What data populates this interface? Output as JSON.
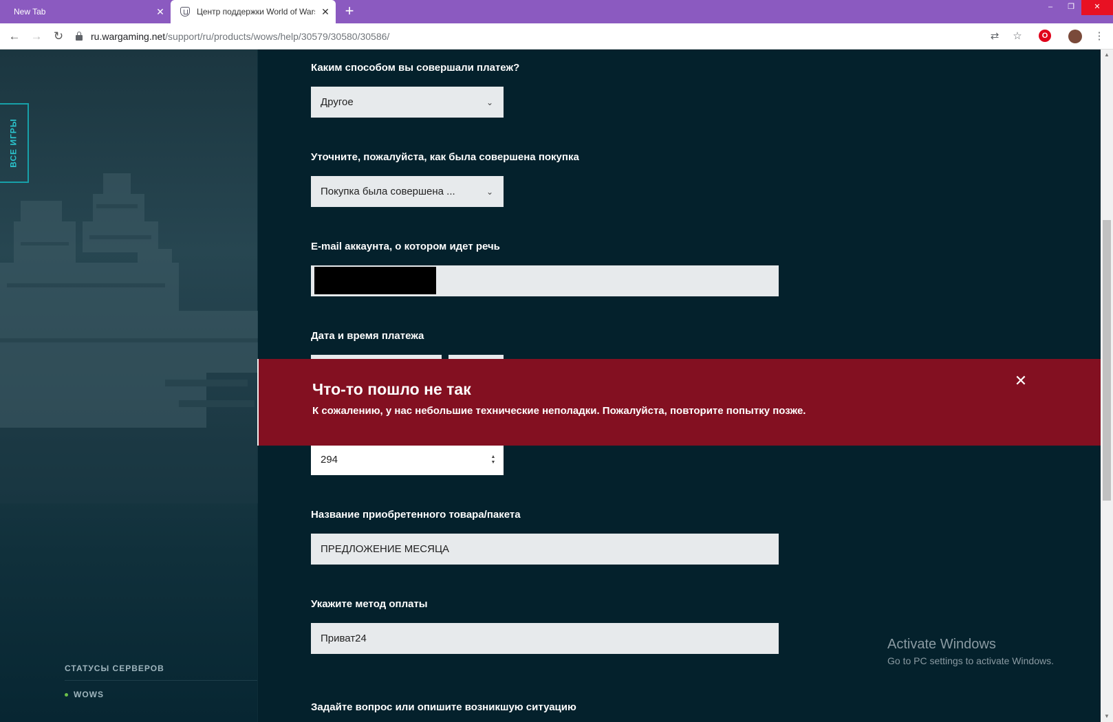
{
  "browser": {
    "tabs": [
      {
        "title": "New Tab"
      },
      {
        "title": "Центр поддержки World of Warships"
      }
    ],
    "new_tab": "+",
    "close": "✕",
    "url_host": "ru.wargaming.net",
    "url_path": "/support/ru/products/wows/help/30579/30580/30586/",
    "window": {
      "minimize": "–",
      "restore": "❐",
      "close": "✕"
    }
  },
  "sidebar": {
    "all_games": "ВСЕ ИГРЫ",
    "server_status_title": "СТАТУСЫ СЕРВЕРОВ",
    "servers": [
      {
        "name": "WOWS",
        "status_color": "#6cc04a"
      }
    ]
  },
  "form": {
    "payment_way": {
      "label": "Каким способом вы совершали платеж?",
      "value": "Другое"
    },
    "purchase_detail": {
      "label": "Уточните, пожалуйста, как была совершена покупка",
      "value": "Покупка была совершена ..."
    },
    "account_email": {
      "label": "E-mail аккаунта, о котором идет речь"
    },
    "payment_datetime": {
      "label": "Дата и время платежа"
    },
    "amount": {
      "value": "294"
    },
    "product_name": {
      "label": "Название приобретенного товара/пакета",
      "value": "ПРЕДЛОЖЕНИЕ МЕСЯЦА"
    },
    "payment_method": {
      "label": "Укажите метод оплаты",
      "value": "Приват24"
    },
    "question": {
      "label": "Задайте вопрос или опишите возникшую ситуацию"
    }
  },
  "error": {
    "title": "Что-то пошло не так",
    "message": "К сожалению, у нас небольшие технические неполадки. Пожалуйста, повторите попытку позже.",
    "color": "#831021"
  },
  "watermark": {
    "title": "Activate Windows",
    "subtitle": "Go to PC settings to activate Windows."
  }
}
